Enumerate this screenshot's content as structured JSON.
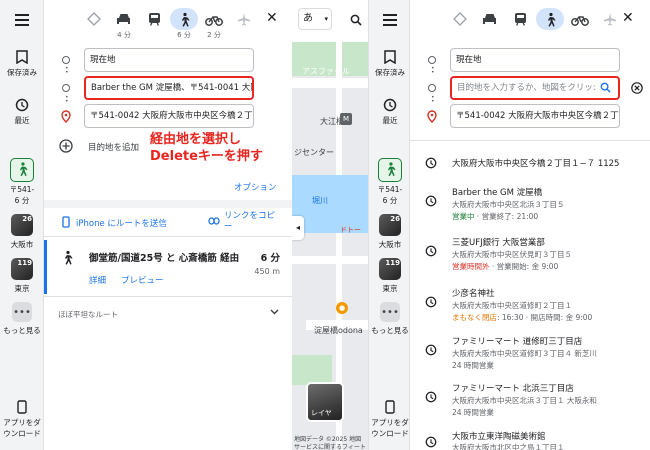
{
  "left_rail": {
    "saved": "保存済み",
    "recent": "最近",
    "walk_dest": "〒541-",
    "walk_time": "6 分",
    "recent_places": [
      {
        "num": "26",
        "label": "大阪市"
      },
      {
        "num": "119",
        "label": "東京"
      }
    ],
    "more": "もっと見る",
    "app_line1": "アプリをダ",
    "app_line2": "ウンロード"
  },
  "left_panel": {
    "modes": [
      {
        "name": "car",
        "time": "4 分"
      },
      {
        "name": "transit",
        "time": ""
      },
      {
        "name": "walk",
        "time": "6 分"
      },
      {
        "name": "bicycle",
        "time": "2 分"
      }
    ],
    "origin": "現在地",
    "waypoint": "Barber the GM 淀屋橋、〒541-0041 大阪",
    "destination": "〒541-0042 大阪府大阪市中央区今橋２丁目",
    "add_destination": "目的地を追加",
    "annotation_line1": "経由地を選択し",
    "annotation_line2": "Deleteキーを押す",
    "options": "オプション",
    "send_to_iphone": "iPhone にルートを送信",
    "copy_link_line1": "リンクをコピ",
    "copy_link_line2": "ー",
    "route_title": "御堂筋/国道25号 と 心斎橋筋 経由",
    "route_time": "6 分",
    "route_distance": "450 m",
    "details": "詳細",
    "preview": "プレビュー",
    "flat_route": "ほぼ平坦なルート"
  },
  "map": {
    "lang": "あ",
    "labels": {
      "asphalt": "アスファール",
      "daie": "大江橋",
      "center": "ジセンター",
      "horikawa": "堀川",
      "dotom": "ドトー",
      "yodoyabashi": "淀屋橋odona",
      "layer": "レイヤ"
    },
    "credit_line1": "地図データ ©2025 地図",
    "credit_line2": "サービスに関するフィート"
  },
  "right_panel": {
    "origin": "現在地",
    "dest_placeholder": "目的地を入力するか、地図をクリッ:",
    "destination": "〒541-0042 大阪府大阪市中央区今橋２丁",
    "suggestions": [
      {
        "title": "大阪府大阪市中央区今橋２丁目１−７ 1125",
        "sub": "",
        "status": "",
        "status_rest": ""
      },
      {
        "title": "Barber the GM 淀屋橋",
        "sub": "大阪府大阪市中央区北浜３丁目５",
        "status": "営業中",
        "status_rest": " · 営業終了: 21:00"
      },
      {
        "title": "三菱UFJ銀行 大阪営業部",
        "sub": "大阪府大阪市中央区伏見町３丁目５",
        "status": "営業時間外",
        "status_rest": " · 営業開始: 金 9:00"
      },
      {
        "title": "少彦名神社",
        "sub": "大阪府大阪市中央区道修町２丁目１",
        "status": "まもなく閉店",
        "status_rest": ": 16:30 · 開店時間: 金 9:00"
      },
      {
        "title": "ファミリーマート 道修町三丁目店",
        "sub": "大阪府大阪市中央区道修町３丁目４ 新芝川",
        "status": "24 時間営業",
        "status_rest": ""
      },
      {
        "title": "ファミリーマート 北浜三丁目店",
        "sub": "大阪府大阪市中央区北浜３丁目１ 大阪永和",
        "status": "24 時間営業",
        "status_rest": ""
      },
      {
        "title": "大阪市立東洋陶磁美術館",
        "sub": "大阪府大阪市北区中之島１丁目１",
        "status": "",
        "status_rest": ""
      }
    ]
  },
  "colors": {
    "accent": "#1a73e8",
    "annotation": "#e8251f",
    "open": "#188038",
    "closed": "#d93025",
    "closing_soon": "#e37400"
  }
}
